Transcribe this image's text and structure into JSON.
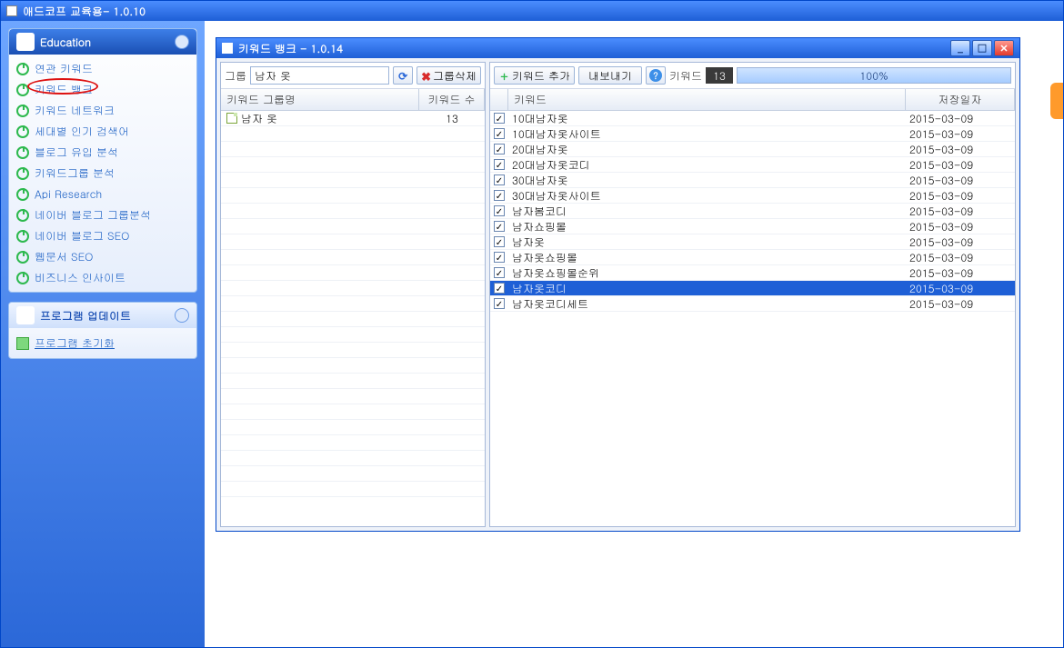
{
  "app": {
    "title": "애드코프 교육용- 1.0.10"
  },
  "sidebar": {
    "education": {
      "title": "Education",
      "items": [
        {
          "label": "연관 키워드"
        },
        {
          "label": "키워드 뱅크",
          "current": true
        },
        {
          "label": "키워드 네트워크"
        },
        {
          "label": "세대별 인기 검색어"
        },
        {
          "label": "블로그 유입 분석"
        },
        {
          "label": "키워드그룹 분석"
        },
        {
          "label": "Api Research"
        },
        {
          "label": "네이버 블로그 그룹분석"
        },
        {
          "label": "네이버 블로그 SEO"
        },
        {
          "label": "웹문서 SEO"
        },
        {
          "label": "비즈니스 인사이트"
        }
      ]
    },
    "update": {
      "title": "프로그램 업데이트",
      "items": [
        {
          "label": "프로그램 초기화"
        }
      ]
    }
  },
  "inner": {
    "title": "키워드 뱅크 - 1.0.14",
    "left_toolbar": {
      "group_label": "그룹",
      "group_value": "남자 옷",
      "delete_label": "그룹삭제"
    },
    "right_toolbar": {
      "add_label": "키워드 추가",
      "export_label": "내보내기",
      "keyword_label": "키워드",
      "keyword_count": "13",
      "progress_pct": "100%"
    },
    "left_grid": {
      "headers": {
        "name": "키워드 그룹명",
        "count": "키워드 수"
      },
      "rows": [
        {
          "name": "남자 옷",
          "count": "13"
        }
      ]
    },
    "right_grid": {
      "headers": {
        "kw": "키워드",
        "date": "저장일자"
      },
      "rows": [
        {
          "kw": "10대남자옷",
          "date": "2015-03-09"
        },
        {
          "kw": "10대남자옷사이트",
          "date": "2015-03-09"
        },
        {
          "kw": "20대남자옷",
          "date": "2015-03-09"
        },
        {
          "kw": "20대남자옷코디",
          "date": "2015-03-09"
        },
        {
          "kw": "30대남자옷",
          "date": "2015-03-09"
        },
        {
          "kw": "30대남자옷사이트",
          "date": "2015-03-09"
        },
        {
          "kw": "남자봄코디",
          "date": "2015-03-09"
        },
        {
          "kw": "남자쇼핑몰",
          "date": "2015-03-09"
        },
        {
          "kw": "남자옷",
          "date": "2015-03-09"
        },
        {
          "kw": "남자옷쇼핑몰",
          "date": "2015-03-09"
        },
        {
          "kw": "남자옷쇼핑몰순위",
          "date": "2015-03-09"
        },
        {
          "kw": "남자옷코디",
          "date": "2015-03-09",
          "selected": true
        },
        {
          "kw": "남자옷코디세트",
          "date": "2015-03-09"
        }
      ]
    }
  }
}
